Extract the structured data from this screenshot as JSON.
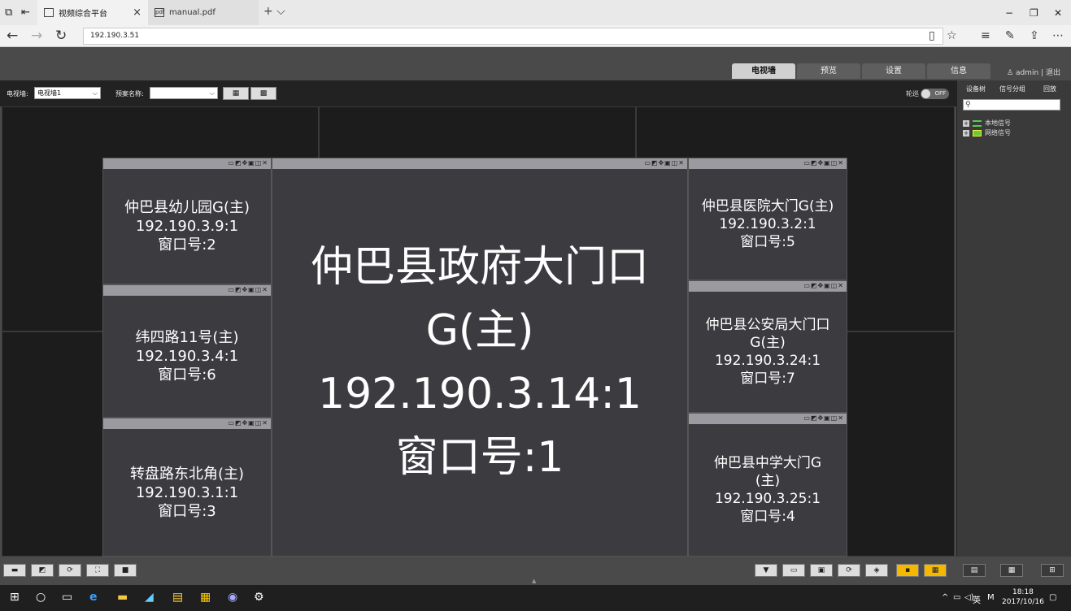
{
  "browser": {
    "tabs": [
      {
        "label": "视频综合平台",
        "active": true
      },
      {
        "label": "manual.pdf",
        "active": false
      }
    ],
    "new_tab": "+",
    "url": "192.190.3.51"
  },
  "app": {
    "nav_tabs": [
      "电视墙",
      "预览",
      "设置",
      "信息"
    ],
    "active_nav": "电视墙",
    "user": "admin",
    "logout": "退出",
    "tv_wall_label": "电视墙:",
    "tv_wall_value": "电视墙1",
    "plan_label": "预案名称:",
    "plan_value": "",
    "patrol_label": "轮巡",
    "patrol_state": "OFF",
    "sidebar": {
      "tabs": [
        "设备树",
        "信号分组",
        "回放"
      ],
      "tree": [
        "本地信号",
        "网络信号"
      ]
    },
    "windows": [
      {
        "id": "w2",
        "lines": [
          "仲巴县幼儿园G(主)",
          "192.190.3.9:1",
          "窗口号:2"
        ]
      },
      {
        "id": "w6",
        "lines": [
          "纬四路11号(主)",
          "192.190.3.4:1",
          "窗口号:6"
        ]
      },
      {
        "id": "w3",
        "lines": [
          "转盘路东北角(主)",
          "192.190.3.1:1",
          "窗口号:3"
        ]
      },
      {
        "id": "w1",
        "lines": [
          "仲巴县政府大门口",
          "G(主)",
          "192.190.3.14:1",
          "窗口号:1"
        ]
      },
      {
        "id": "w5",
        "lines": [
          "仲巴县医院大门G(主)",
          "192.190.3.2:1",
          "窗口号:5"
        ]
      },
      {
        "id": "w7",
        "lines": [
          "仲巴县公安局大门口",
          "G(主)",
          "192.190.3.24:1",
          "窗口号:7"
        ]
      },
      {
        "id": "w4",
        "lines": [
          "仲巴县中学大门G",
          "(主)",
          "192.190.3.25:1",
          "窗口号:4"
        ]
      }
    ]
  },
  "taskbar": {
    "tray_lang": "英",
    "time": "18:18",
    "date": "2017/10/16"
  }
}
